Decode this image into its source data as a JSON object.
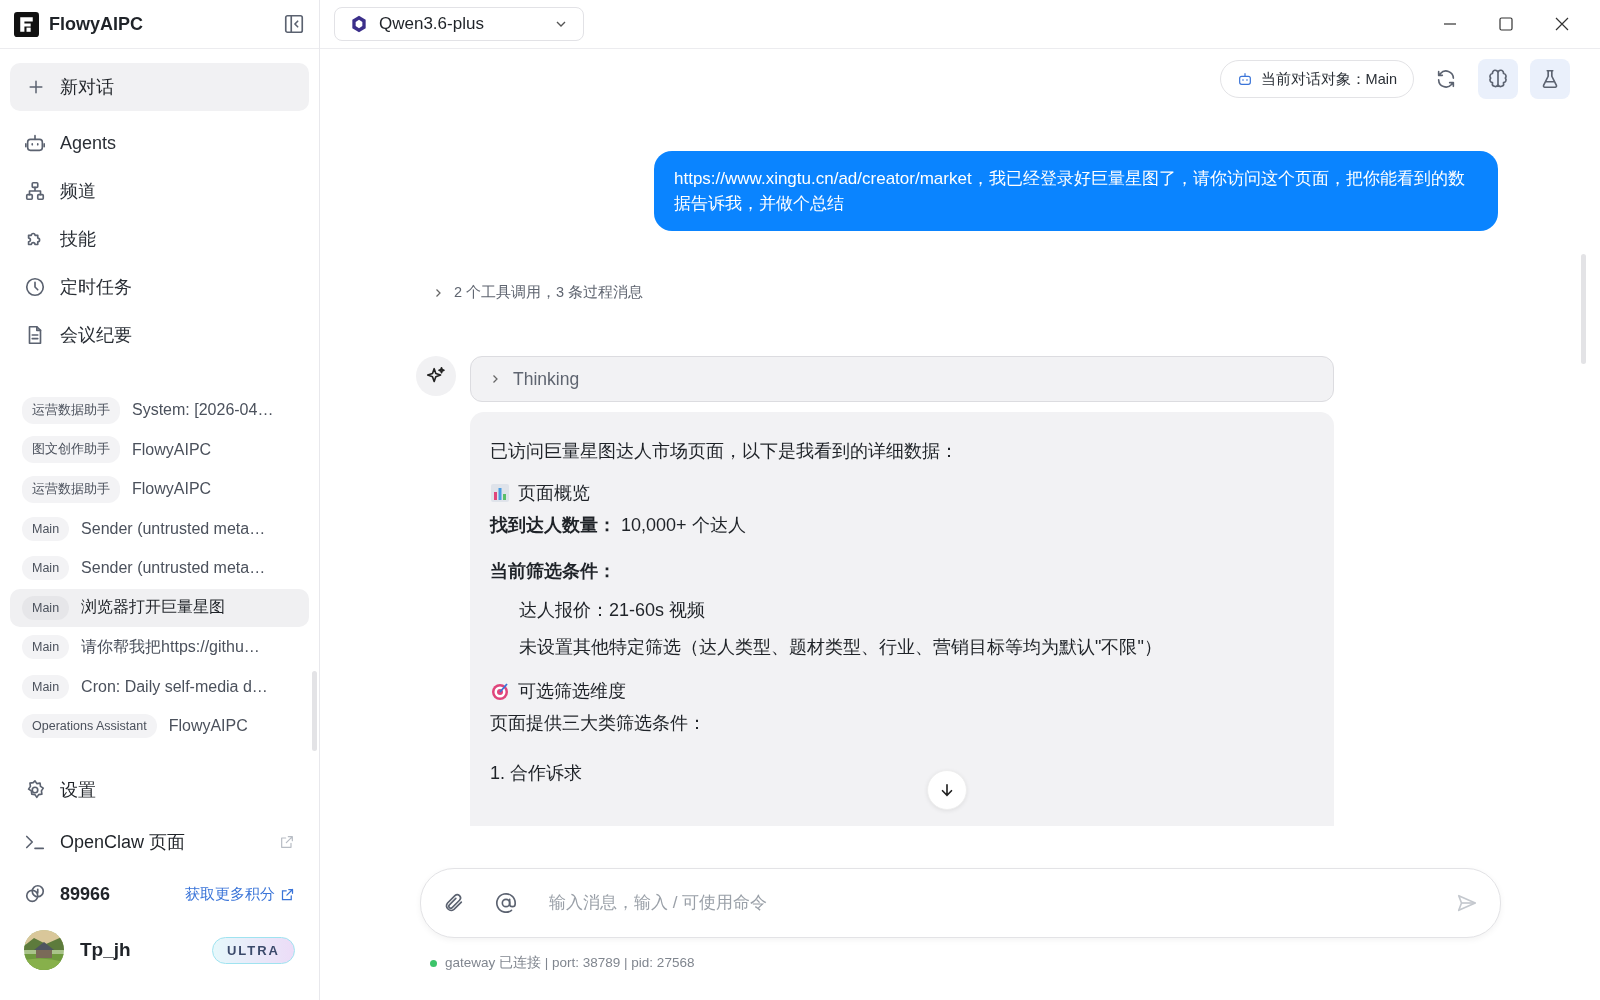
{
  "app": {
    "name": "FlowyAIPC"
  },
  "sidebar": {
    "new_chat": "新对话",
    "nav": [
      {
        "label": "Agents"
      },
      {
        "label": "频道"
      },
      {
        "label": "技能"
      },
      {
        "label": "定时任务"
      },
      {
        "label": "会议纪要"
      }
    ],
    "conversations": [
      {
        "agent": "运营数据助手",
        "title": "System: [2026-04…",
        "selected": false
      },
      {
        "agent": "图文创作助手",
        "title": "FlowyAIPC",
        "selected": false
      },
      {
        "agent": "运营数据助手",
        "title": "FlowyAIPC",
        "selected": false
      },
      {
        "agent": "Main",
        "title": "Sender (untrusted meta…",
        "selected": false
      },
      {
        "agent": "Main",
        "title": "Sender (untrusted meta…",
        "selected": false
      },
      {
        "agent": "Main",
        "title": "浏览器打开巨量星图",
        "selected": true
      },
      {
        "agent": "Main",
        "title": "请你帮我把https://githu…",
        "selected": false
      },
      {
        "agent": "Main",
        "title": "Cron: Daily self-media d…",
        "selected": false
      },
      {
        "agent": "Operations Assistant",
        "title": "FlowyAIPC",
        "selected": false
      }
    ],
    "settings": "设置",
    "openclaw": "OpenClaw 页面",
    "points": {
      "value": "89966",
      "link": "获取更多积分"
    },
    "user": {
      "name": "Tp_jh",
      "badge": "ULTRA"
    }
  },
  "topbar": {
    "model": "Qwen3.6-plus"
  },
  "chat": {
    "target": "当前对话对象：Main",
    "user_message": "https://www.xingtu.cn/ad/creator/market，我已经登录好巨量星图了，请你访问这个页面，把你能看到的数据告诉我，并做个总结",
    "tool_summary": "2 个工具调用，3 条过程消息",
    "thinking": "Thinking",
    "answer": [
      {
        "kind": "text",
        "text": "已访问巨量星图达人市场页面，以下是我看到的详细数据："
      },
      {
        "kind": "heading",
        "text": "页面概览"
      },
      {
        "kind": "text",
        "text": "**找到达人数量：** 10,000+ 个达人"
      },
      {
        "kind": "subheading",
        "text": "当前筛选条件："
      },
      {
        "kind": "indent",
        "text": "达人报价：21-60s 视频"
      },
      {
        "kind": "indent",
        "text": "未设置其他特定筛选（达人类型、题材类型、行业、营销目标等均为默认\"不限\"）"
      },
      {
        "kind": "heading",
        "text": "可选筛选维度"
      },
      {
        "kind": "text",
        "text": "页面提供三大类筛选条件："
      },
      {
        "kind": "item",
        "text": "1. 合作诉求"
      }
    ]
  },
  "input": {
    "placeholder": "输入消息，输入 / 可使用命令"
  },
  "status": {
    "connected": true,
    "text": "gateway 已连接 | port: 38789 | pid: 27568"
  }
}
